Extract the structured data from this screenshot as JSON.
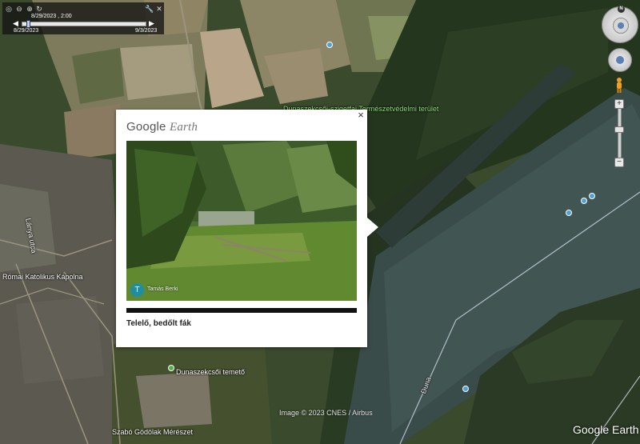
{
  "time_slider": {
    "current_time": "8/29/2023 , 2:00",
    "start_date": "8/29/2023",
    "end_date": "9/3/2023"
  },
  "map_labels": {
    "protected_area": "Dunaszekcsői-szigetfai Természetvédelmi terület",
    "church": "Római Katolikus Kápolna",
    "street": "Lánya utca",
    "cemetery": "Dunaszekcsői temető",
    "winery": "Szabó Gödölak Mérészet",
    "river": "Duna"
  },
  "popup": {
    "brand_plain": "Google",
    "brand_italic": "Earth",
    "close_label": "×",
    "avatar_initial": "T",
    "photo_author": "Tamás Berki",
    "caption": "Telelő, bedőlt fák"
  },
  "navigation": {
    "compass_north": "N",
    "zoom_in": "+",
    "zoom_out": "−"
  },
  "footer": {
    "image_credit": "Image © 2023 CNES / Airbus",
    "logo": "Google Earth"
  },
  "icons": [
    "globe-icon",
    "zoom-out-icon",
    "zoom-in-icon",
    "refresh-icon",
    "wrench-icon",
    "close-icon",
    "play-icon",
    "rewind-icon",
    "compass-icon",
    "look-icon",
    "pegman-icon"
  ]
}
